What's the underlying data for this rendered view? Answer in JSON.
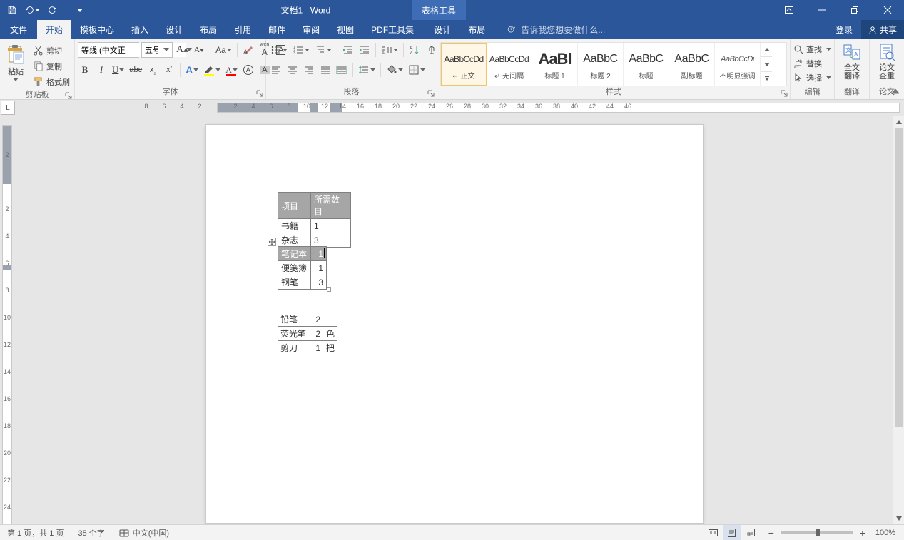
{
  "title": "文档1 - Word",
  "context_tool_title": "表格工具",
  "tabs": {
    "file": "文件",
    "home": "开始",
    "template": "模板中心",
    "insert": "插入",
    "design": "设计",
    "layout": "布局",
    "references": "引用",
    "mailings": "邮件",
    "review": "审阅",
    "view": "视图",
    "pdf": "PDF工具集",
    "ctx_design": "设计",
    "ctx_layout": "布局",
    "login": "登录",
    "share": "共享"
  },
  "tellme_placeholder": "告诉我您想要做什么...",
  "clipboard": {
    "paste": "粘贴",
    "cut": "剪切",
    "copy": "复制",
    "format_painter": "格式刷",
    "group": "剪贴板"
  },
  "font": {
    "name_value": "等线 (中文正",
    "size_value": "五号",
    "group": "字体"
  },
  "para": {
    "group": "段落"
  },
  "styles": {
    "group": "样式",
    "items": [
      {
        "preview": "AaBbCcDd",
        "name": "↵ 正文",
        "cls": ""
      },
      {
        "preview": "AaBbCcDd",
        "name": "↵ 无间隔",
        "cls": ""
      },
      {
        "preview": "AaBl",
        "name": "标题 1",
        "cls": "big"
      },
      {
        "preview": "AaBbC",
        "name": "标题 2",
        "cls": ""
      },
      {
        "preview": "AaBbC",
        "name": "标题",
        "cls": ""
      },
      {
        "preview": "AaBbC",
        "name": "副标题",
        "cls": ""
      },
      {
        "preview": "AaBbCcDi",
        "name": "不明显强调",
        "cls": "small"
      }
    ]
  },
  "editing": {
    "find": "查找",
    "replace": "替换",
    "select": "选择",
    "group": "编辑"
  },
  "translate": {
    "label": "全文\n翻译",
    "group": "翻译"
  },
  "thesis": {
    "label": "论文\n查重",
    "group": "论文"
  },
  "tabwell": "L",
  "hruler_numbers": [
    "8",
    "6",
    "4",
    "2",
    "",
    "2",
    "4",
    "6",
    "8",
    "10",
    "12",
    "14",
    "16",
    "18",
    "20",
    "22",
    "24",
    "26",
    "28",
    "30",
    "32",
    "34",
    "36",
    "38",
    "40",
    "42",
    "44",
    "46"
  ],
  "vruler_numbers": [
    "",
    "2",
    "",
    "2",
    "4",
    "6",
    "8",
    "10",
    "12",
    "14",
    "16",
    "18",
    "20",
    "22",
    "24"
  ],
  "doc": {
    "table1": {
      "headers": [
        "项目",
        "所需数目"
      ],
      "rows": [
        [
          "书籍",
          "1"
        ],
        [
          "杂志",
          "3"
        ]
      ]
    },
    "table2": {
      "headers": [
        "笔记本",
        "1"
      ],
      "rows": [
        [
          "便笺簿",
          "1"
        ],
        [
          "钢笔",
          "3"
        ]
      ]
    },
    "table3": {
      "rows": [
        [
          "铅笔",
          "2",
          ""
        ],
        [
          "荧光笔",
          "2",
          "色"
        ],
        [
          "剪刀",
          "1",
          "把"
        ]
      ]
    }
  },
  "status": {
    "page": "第 1 页，共 1 页",
    "words": "35 个字",
    "lang": "中文(中国)",
    "zoom": "100%"
  }
}
